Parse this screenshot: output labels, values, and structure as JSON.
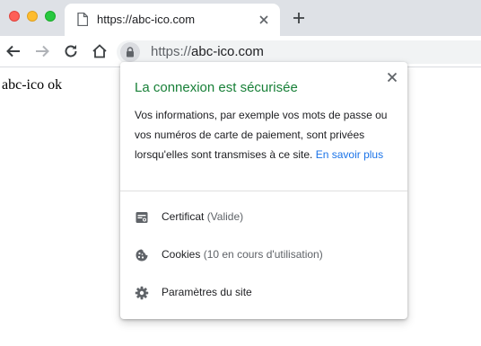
{
  "tab": {
    "title": "https://abc-ico.com"
  },
  "omnibox": {
    "scheme": "https://",
    "host": "abc-ico.com"
  },
  "page": {
    "body_text": "abc-ico ok"
  },
  "popup": {
    "title": "La connexion est sécurisée",
    "description": "Vos informations, par exemple vos mots de passe ou vos numéros de carte de paiement, sont privées lorsqu'elles sont transmises à ce site.",
    "learn_more": "En savoir plus",
    "rows": [
      {
        "label": "Certificat",
        "sub": "(Valide)",
        "icon": "certificate-icon"
      },
      {
        "label": "Cookies",
        "sub": "(10 en cours d'utilisation)",
        "icon": "cookie-icon"
      },
      {
        "label": "Paramètres du site",
        "sub": "",
        "icon": "gear-icon"
      }
    ]
  },
  "colors": {
    "secure_title": "#188038",
    "link": "#1a73e8",
    "tabstrip": "#dee1e6",
    "omnibox": "#f1f3f4"
  }
}
